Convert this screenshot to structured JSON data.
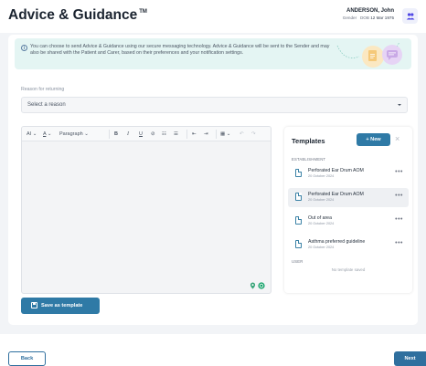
{
  "header": {
    "title": "Advice & Guidance",
    "trademark": "TM",
    "patient_name": "ANDERSON, John",
    "gender_label": "Gender",
    "dob_label": "DOB",
    "dob_value": "12 Mar 1975",
    "patient_icon": "people-icon"
  },
  "info": {
    "text": "You can choose to send Advice & Guidance using our secure messaging technology. Advice & Guidance will be sent to the Sender and may also be shared with the Patient and Carer, based on their preferences and your notification settings.",
    "icon": "info-icon"
  },
  "reason": {
    "label": "Reason for returning",
    "value": "Select a reason"
  },
  "toolbar": {
    "ai": "AI",
    "text_color": "A",
    "paragraph": "Paragraph",
    "bold": "B",
    "italic": "I",
    "underline": "U"
  },
  "save_template_label": "Save as template",
  "templates": {
    "title": "Templates",
    "new_label": "+ New",
    "section_establishment": "ESTABLISHMENT",
    "section_user": "USER",
    "empty_text": "No template saved",
    "items": [
      {
        "name": "Perforated Ear Drum AOM",
        "date": "20 October 2024"
      },
      {
        "name": "Perforated Ear Drum AOM",
        "date": "20 October 2024"
      },
      {
        "name": "Out of area",
        "date": "20 October 2024"
      },
      {
        "name": "Asthma preferred guideline",
        "date": "20 October 2024"
      }
    ]
  },
  "footer": {
    "back_label": "Back",
    "next_label": "Next"
  },
  "colors": {
    "primary": "#2f7aa6",
    "info_bg": "#e4f5f3",
    "accent_orange": "#f5c97a",
    "accent_purple": "#c9a9e6"
  }
}
